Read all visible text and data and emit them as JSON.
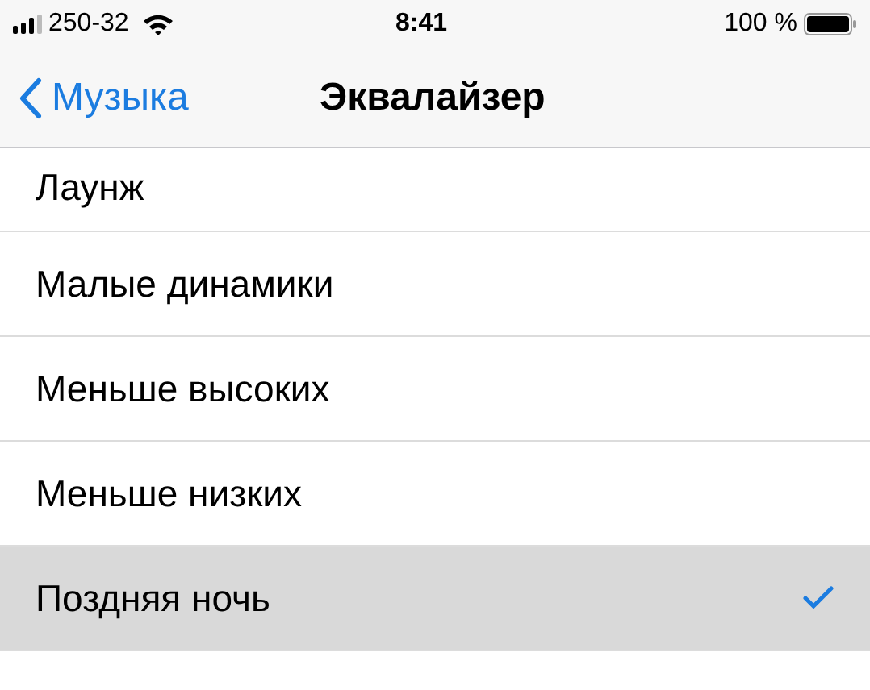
{
  "status_bar": {
    "carrier": "250-32",
    "time": "8:41",
    "battery": "100 %"
  },
  "nav": {
    "back": "Музыка",
    "title": "Эквалайзер"
  },
  "items": [
    {
      "label": "Лаунж",
      "selected": false,
      "checked": false
    },
    {
      "label": "Малые динамики",
      "selected": false,
      "checked": false
    },
    {
      "label": "Меньше высоких",
      "selected": false,
      "checked": false
    },
    {
      "label": "Меньше низких",
      "selected": false,
      "checked": false
    },
    {
      "label": "Поздняя ночь",
      "selected": true,
      "checked": true
    }
  ]
}
